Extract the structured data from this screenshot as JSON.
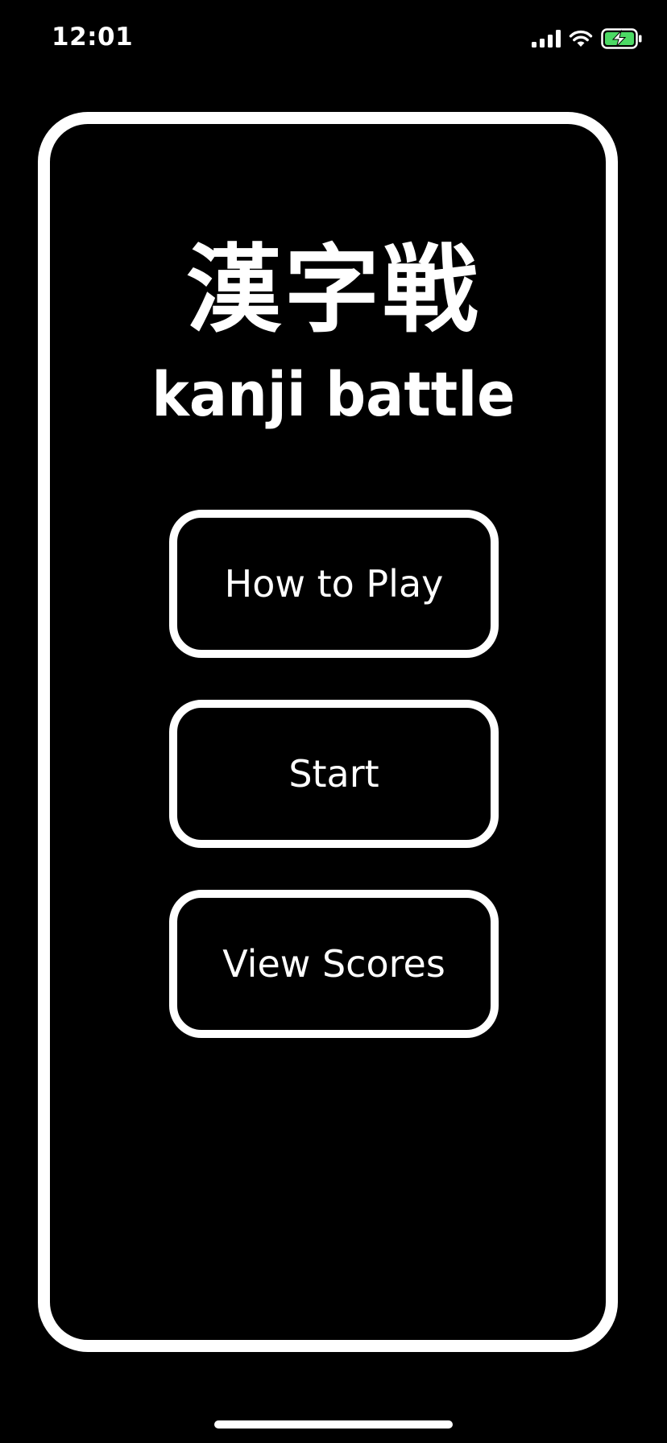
{
  "status_bar": {
    "time": "12:01",
    "icons": [
      "cellular-signal-icon",
      "wifi-icon",
      "battery-charging-icon"
    ],
    "battery_color": "#4cd964"
  },
  "title": {
    "kanji": "漢字戦",
    "romaji": "kanji battle"
  },
  "menu": {
    "how_to_play": "How to Play",
    "start": "Start",
    "view_scores": "View Scores"
  },
  "colors": {
    "background": "#000000",
    "foreground": "#ffffff"
  }
}
